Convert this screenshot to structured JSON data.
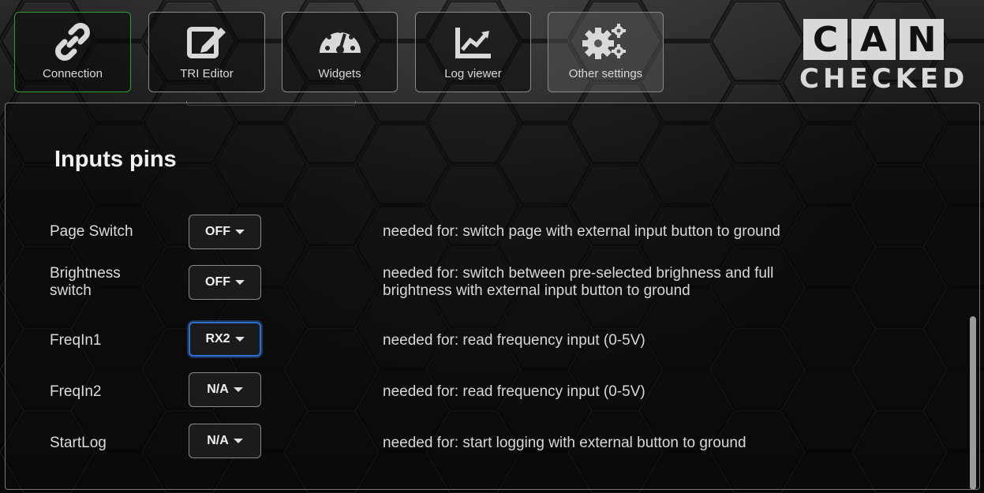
{
  "nav": [
    {
      "id": "connection",
      "label": "Connection",
      "icon": "link-icon",
      "active": true
    },
    {
      "id": "tri",
      "label": "TRI Editor",
      "icon": "edit-icon",
      "active": false
    },
    {
      "id": "widgets",
      "label": "Widgets",
      "icon": "gauge-icon",
      "active": false
    },
    {
      "id": "log",
      "label": "Log viewer",
      "icon": "chart-icon",
      "active": false
    },
    {
      "id": "other",
      "label": "Other settings",
      "icon": "gears-icon",
      "active": false
    }
  ],
  "logo": {
    "letters": [
      "C",
      "A",
      "N"
    ],
    "subtitle": "CHECKED"
  },
  "section": {
    "title": "Inputs pins"
  },
  "pins": [
    {
      "label": "Page Switch",
      "value": "OFF",
      "description": "needed for: switch page with external input button to ground"
    },
    {
      "label": "Brightness\nswitch",
      "value": "OFF",
      "description": "needed for: switch between pre-selected brighness and full\nbrightness with external input button to ground"
    },
    {
      "label": "FreqIn1",
      "value": "RX2",
      "description": "needed for: read frequency input (0-5V)"
    },
    {
      "label": "FreqIn2",
      "value": "N/A",
      "description": "needed for: read frequency input (0-5V)"
    },
    {
      "label": "StartLog",
      "value": "N/A",
      "description": "needed for: start logging with external button to ground"
    }
  ],
  "colors": {
    "active_border": "#2ea02e",
    "focus_border": "#2a6fd0"
  }
}
